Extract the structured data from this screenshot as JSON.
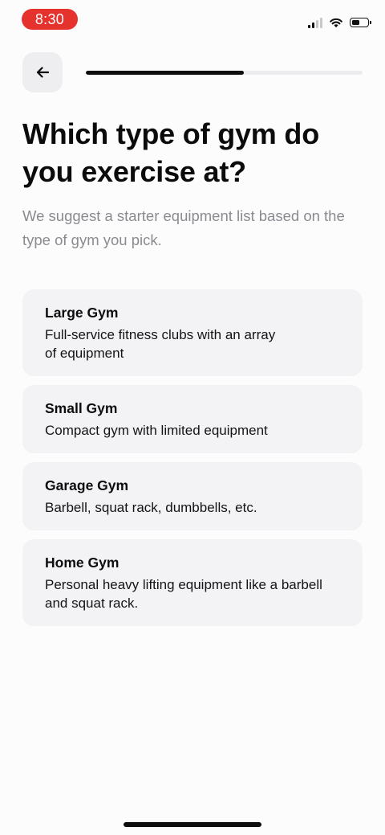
{
  "status_bar": {
    "time": "8:30",
    "time_pill_color": "#e5322c",
    "icons": [
      "signal-icon",
      "wifi-icon",
      "battery-icon"
    ],
    "battery_level": 0.5
  },
  "header": {
    "back_icon": "arrow-left-icon",
    "progress": 0.57
  },
  "title": "Which type of gym do you exercise at?",
  "subtitle": "We suggest a starter equipment list based on the type of gym you pick.",
  "options": [
    {
      "title": "Large Gym",
      "description": "Full-service fitness clubs with an array of equipment"
    },
    {
      "title": "Small Gym",
      "description": "Compact gym with limited equipment"
    },
    {
      "title": "Garage Gym",
      "description": "Barbell, squat rack, dumbbells, etc."
    },
    {
      "title": "Home Gym",
      "description": "Personal heavy lifting equipment like a barbell and squat rack."
    }
  ]
}
